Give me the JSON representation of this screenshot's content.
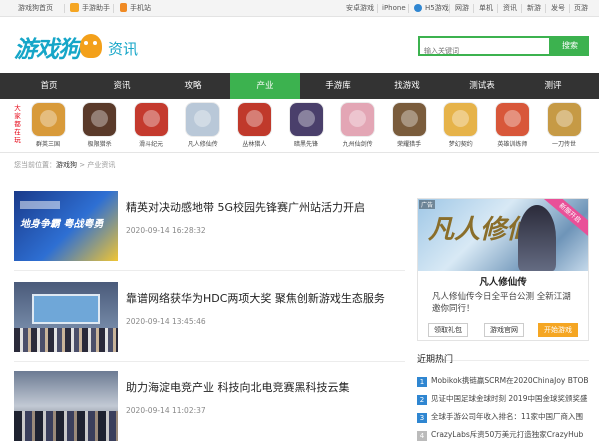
{
  "topbar": {
    "left": [
      {
        "label": "游戏狗首页",
        "icon": ""
      },
      {
        "label": "手游助手",
        "icon": "phone-helper-icon"
      },
      {
        "label": "手机站",
        "icon": "mobile-site-icon"
      }
    ],
    "right": [
      "安卓游戏",
      "iPhone",
      "H5游戏",
      "网游",
      "单机",
      "资讯",
      "新游",
      "发号",
      "页游"
    ]
  },
  "logo": {
    "main": "游戏狗",
    "sub": "资讯"
  },
  "search": {
    "placeholder": "输入关键词",
    "button": "搜索"
  },
  "nav": {
    "items": [
      "首页",
      "资讯",
      "攻略",
      "产业",
      "手游库",
      "找游戏",
      "测试表",
      "测评"
    ],
    "active": 3
  },
  "games": {
    "side_label": "大家都在玩",
    "items": [
      {
        "name": "群英三国",
        "color": "#d89a3a"
      },
      {
        "name": "极限猎杀",
        "color": "#5a3a2a"
      },
      {
        "name": "滑斗纪元",
        "color": "#c43a2e"
      },
      {
        "name": "凡人修仙传",
        "color": "#b9c8d8"
      },
      {
        "name": "丛林猎人",
        "color": "#c0392b"
      },
      {
        "name": "暗黑先锋",
        "color": "#4a3f6b"
      },
      {
        "name": "九州仙剑传",
        "color": "#e3a6b5"
      },
      {
        "name": "荣耀猎手",
        "color": "#7a5c3c"
      },
      {
        "name": "梦幻契约",
        "color": "#e6b34a"
      },
      {
        "name": "英雄训练师",
        "color": "#d8573a"
      },
      {
        "name": "一刀传世",
        "color": "#c69a45"
      }
    ]
  },
  "breadcrumb": {
    "prefix": "您当前位置：",
    "home": "游戏狗",
    "sep": " > ",
    "current": "产业资讯"
  },
  "articles": [
    {
      "title": "精英对决动感地带 5G校园先锋赛广州站活力开启",
      "date": "2020-09-14 16:28:32",
      "thumb": "地身争霸 粤战粤勇"
    },
    {
      "title": "靠谱网络获华为HDC两项大奖 聚焦创新游戏生态服务",
      "date": "2020-09-14 13:45:46",
      "thumb": ""
    },
    {
      "title": "助力海淀电竞产业 科技向北电竞赛黑科技云集",
      "date": "2020-09-14 11:02:37",
      "thumb": ""
    }
  ],
  "sidebar_game": {
    "ad_label": "广告",
    "ribbon": "新服开启",
    "banner_logo": "凡人修仙",
    "title": "凡人修仙传",
    "desc": "凡人修仙传今日全平台公测 全新江湖邀你同行！",
    "buttons": [
      "领取礼包",
      "游戏官网",
      "开始游戏"
    ]
  },
  "recent": {
    "title": "近期热门",
    "items": [
      {
        "num": "1",
        "text": "Mobikok携链赢SCRM在2020ChinaJoy BTOB",
        "color": "#2f86d1"
      },
      {
        "num": "2",
        "text": "见证中国足球金球时刻 2019中国金球奖颁奖盛",
        "color": "#2f86d1"
      },
      {
        "num": "3",
        "text": "全球手游公司年收入排名：11家中国厂商入围",
        "color": "#2f86d1"
      },
      {
        "num": "4",
        "text": "CrazyLabs斥资50万美元打造独家CrazyHub",
        "color": "#bbb"
      }
    ]
  }
}
